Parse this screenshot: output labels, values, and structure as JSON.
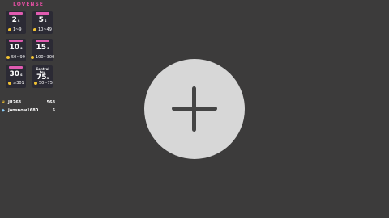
{
  "brand": "LOVENSE",
  "tiers": [
    {
      "level": "2",
      "unit": "s",
      "range": "1~9",
      "accent": "#e05bb0"
    },
    {
      "level": "5",
      "unit": "s",
      "range": "10~49",
      "accent": "#e05bb0"
    },
    {
      "level": "10",
      "unit": "s",
      "range": "50~99",
      "accent": "#e05bb0"
    },
    {
      "level": "15",
      "unit": "s",
      "range": "100~300",
      "accent": "#e05bb0"
    },
    {
      "level": "30",
      "unit": "s",
      "range": "≥301",
      "accent": "#e05bb0"
    },
    {
      "title": "Control toy",
      "level": "75",
      "unit": "s",
      "range": "50~75",
      "accent": "#2b2a34"
    }
  ],
  "leaderboard": [
    {
      "icon": "trophy-icon",
      "name": "JR263",
      "score": "568"
    },
    {
      "icon": "diamond-icon",
      "name": "jonsnow1680",
      "score": "5"
    }
  ],
  "colors": {
    "background": "#3c3b3b",
    "brand": "#e04fa0",
    "coin": "#f1c232",
    "circle": "#d7d7d7"
  }
}
